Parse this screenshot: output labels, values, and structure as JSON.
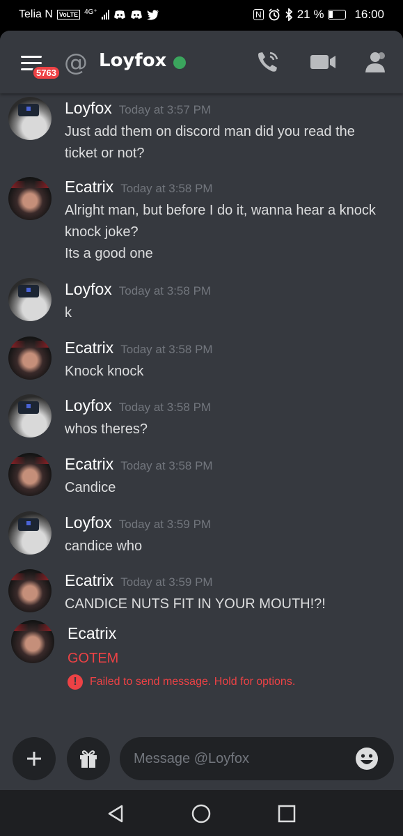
{
  "status_bar": {
    "carrier": "Telia N",
    "volte": "VoLTE",
    "network": "4G⁺",
    "battery": "21 %",
    "time": "16:00",
    "icons": [
      "discord-icon",
      "discord-icon",
      "twitter-icon",
      "nfc-icon",
      "alarm-icon",
      "bluetooth-icon",
      "battery-icon"
    ]
  },
  "header": {
    "menu_badge": "5763",
    "dm_name": "Loyfox",
    "status_color": "#3ba55d",
    "icons": [
      "menu-icon",
      "at-icon",
      "call-icon",
      "video-icon",
      "members-icon"
    ]
  },
  "messages": [
    {
      "author": "Loyfox",
      "timestamp": "Today at 3:57 PM",
      "lines": [
        "Just add them on discord man did you read the",
        "ticket or not?"
      ]
    },
    {
      "author": "Ecatrix",
      "timestamp": "Today at 3:58 PM",
      "lines": [
        "Alright man, but before I do it, wanna hear a knock",
        "knock joke?",
        "Its a good one"
      ]
    },
    {
      "author": "Loyfox",
      "timestamp": "Today at 3:58 PM",
      "lines": [
        "k"
      ]
    },
    {
      "author": "Ecatrix",
      "timestamp": "Today at 3:58 PM",
      "lines": [
        "Knock knock"
      ]
    },
    {
      "author": "Loyfox",
      "timestamp": "Today at 3:58 PM",
      "lines": [
        "whos theres?"
      ]
    },
    {
      "author": "Ecatrix",
      "timestamp": "Today at 3:58 PM",
      "lines": [
        "Candice"
      ]
    },
    {
      "author": "Loyfox",
      "timestamp": "Today at 3:59 PM",
      "lines": [
        "candice who"
      ]
    },
    {
      "author": "Ecatrix",
      "timestamp": "Today at 3:59 PM",
      "lines": [
        "CANDICE NUTS FIT IN YOUR MOUTH!?!"
      ]
    },
    {
      "author": "Ecatrix",
      "lines": [
        "GOTEM"
      ],
      "failed": true
    }
  ],
  "failed_notice": "Failed to send message. Hold for options.",
  "error_color": "#ed4245",
  "composer": {
    "placeholder": "Message @Loyfox",
    "icons": [
      "plus-icon",
      "gift-icon",
      "emoji-icon"
    ]
  },
  "nav": {
    "icons": [
      "back-icon",
      "home-icon",
      "recents-icon"
    ]
  }
}
